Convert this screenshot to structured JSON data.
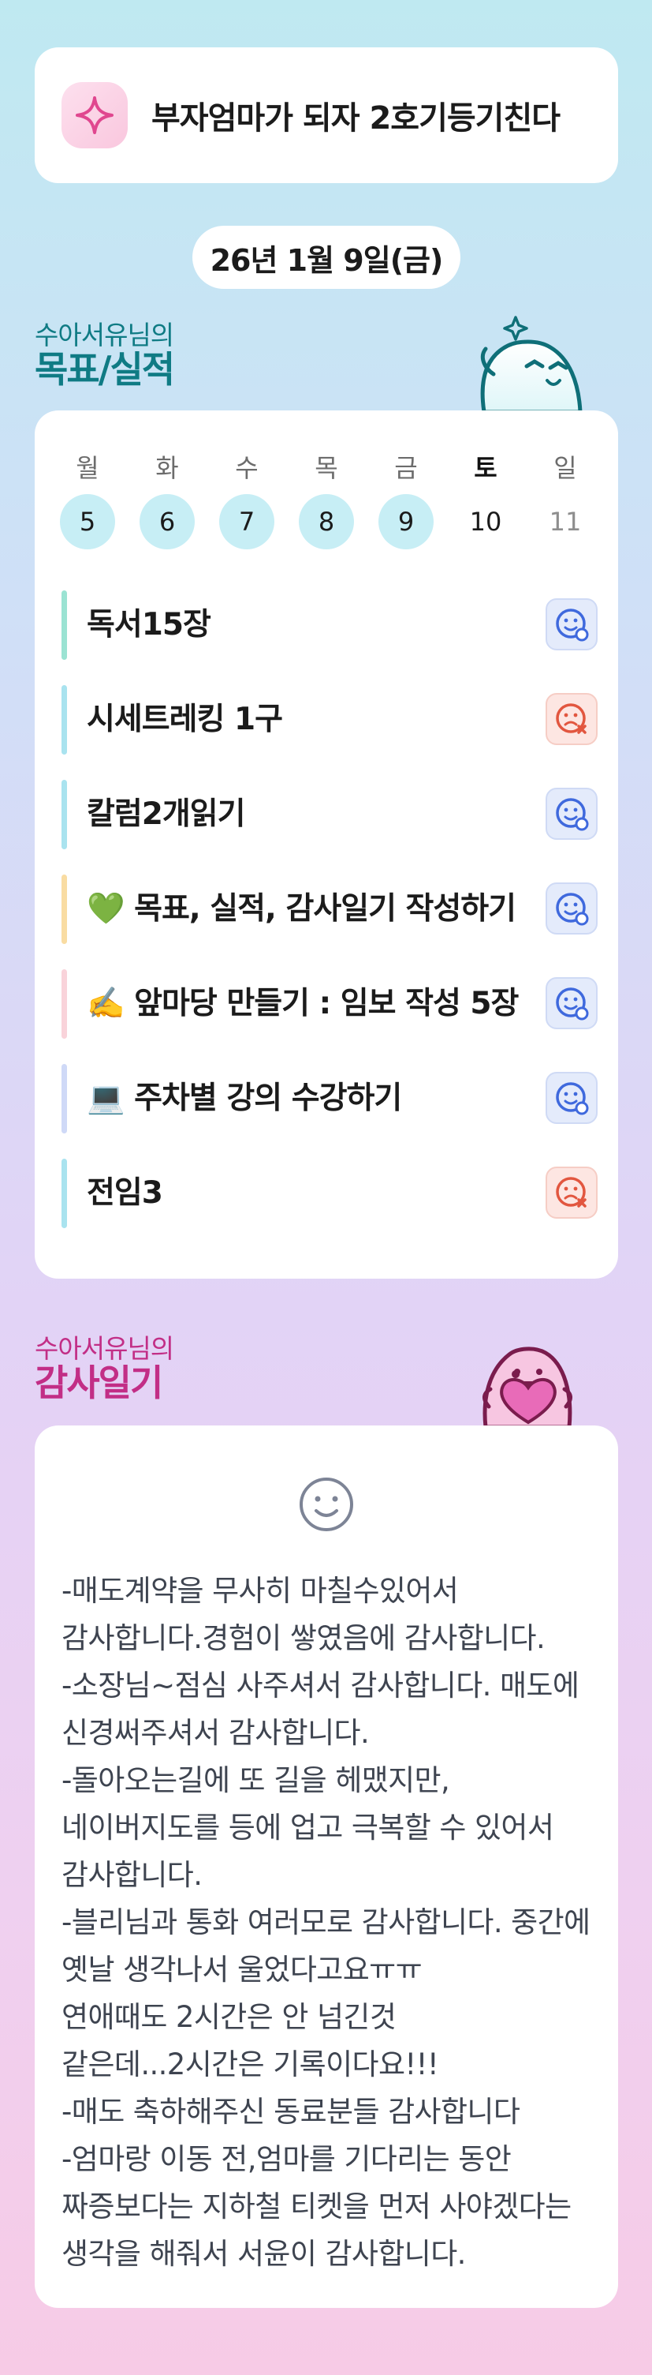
{
  "header": {
    "title": "부자엄마가 되자 2호기등기친다",
    "icon": "sparkle-icon"
  },
  "date_label": "26년 1월 9일(금)",
  "goals_section": {
    "subtitle": "수아서유님의",
    "title": "목표/실적"
  },
  "week": {
    "days": [
      {
        "name": "월",
        "date": "5",
        "done": true
      },
      {
        "name": "화",
        "date": "6",
        "done": true
      },
      {
        "name": "수",
        "date": "7",
        "done": true
      },
      {
        "name": "목",
        "date": "8",
        "done": true
      },
      {
        "name": "금",
        "date": "9",
        "done": true
      },
      {
        "name": "토",
        "date": "10",
        "done": false
      },
      {
        "name": "일",
        "date": "11",
        "done": false
      }
    ]
  },
  "goals": [
    {
      "text": "독서15장",
      "status": "success",
      "bar_color": "#9be3d3"
    },
    {
      "text": "시세트레킹 1구",
      "status": "fail",
      "bar_color": "#a9e3ef"
    },
    {
      "text": "칼럼2개읽기",
      "status": "success",
      "bar_color": "#a9e3ef"
    },
    {
      "text": "💚 목표, 실적, 감사일기 작성하기",
      "status": "success",
      "bar_color": "#f9dca2"
    },
    {
      "text": "✍️ 앞마당 만들기 : 임보 작성 5장",
      "status": "success",
      "bar_color": "#f9d3da"
    },
    {
      "text": "💻 주차별 강의 수강하기",
      "status": "success",
      "bar_color": "#cfd9f7"
    },
    {
      "text": "전임3",
      "status": "fail",
      "bar_color": "#a9e3ef"
    }
  ],
  "gratitude_section": {
    "subtitle": "수아서유님의",
    "title": "감사일기"
  },
  "gratitude_text": "-매도계약을 무사히 마칠수있어서 감사합니다.경험이 쌓였음에 감사합니다.\n-소장님~점심 사주셔서 감사합니다. 매도에 신경써주셔서 감사합니다.\n-돌아오는길에 또 길을 헤맸지만,네이버지도를 등에 업고 극복할 수 있어서 감사합니다.\n-블리님과 통화 여러모로 감사합니다. 중간에 옛날 생각나서 울었다고요ㅠㅠ\n연애때도 2시간은 안 넘긴것 같은데...2시간은 기록이다요!!!\n-매도 축하해주신 동료분들 감사합니다\n-엄마랑 이동 전,엄마를 기다리는 동안 짜증보다는 지하철 티켓을 먼저 사야겠다는 생각을 해줘서 서윤이 감사합니다."
}
